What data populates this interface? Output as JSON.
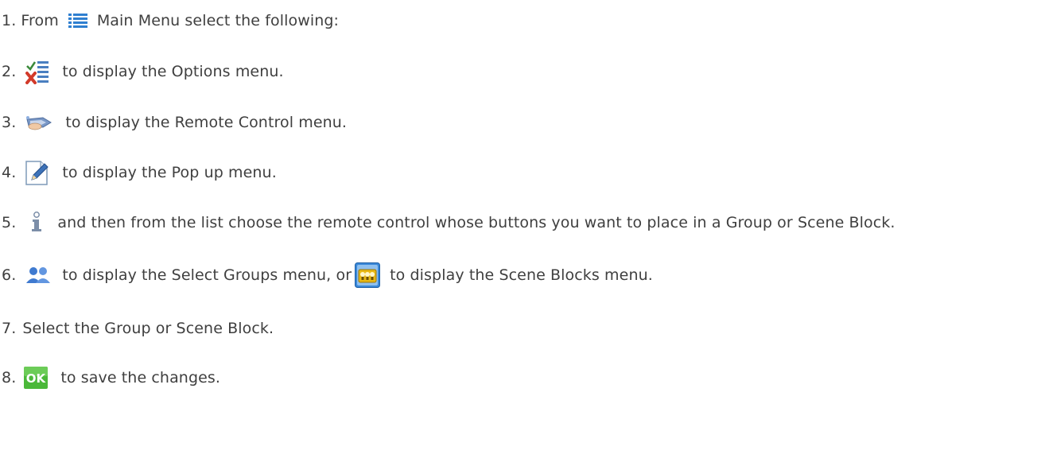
{
  "steps": [
    {
      "number": "1.",
      "before_icon": "From",
      "icon": "main-menu-list-icon",
      "text": "Main Menu select the following:"
    },
    {
      "number": "2.",
      "icon": "options-checklist-icon",
      "text": "to display the Options menu."
    },
    {
      "number": "3.",
      "icon": "remote-control-icon",
      "text": "to display the Remote Control menu."
    },
    {
      "number": "4.",
      "icon": "edit-document-icon",
      "text": "to display the Pop up menu."
    },
    {
      "number": "5.",
      "icon": "info-icon",
      "text": "and then from the list choose the remote control whose buttons you want to place in a Group or Scene Block."
    },
    {
      "number": "6.",
      "icon": "select-groups-icon",
      "text": "to display the Select Groups menu, or",
      "icon2": "scene-blocks-icon",
      "text2": "to display the Scene Blocks menu."
    },
    {
      "number": "7.",
      "text": "Select the Group or Scene Block."
    },
    {
      "number": "8.",
      "icon": "ok-icon",
      "icon_label": "OK",
      "text": "to save the changes."
    }
  ],
  "colors": {
    "text": "#3f3f3f",
    "menu_icon_blue": "#2f7fd0",
    "ok_green": "#4bb83a",
    "scene_gold": "#f2c418"
  }
}
